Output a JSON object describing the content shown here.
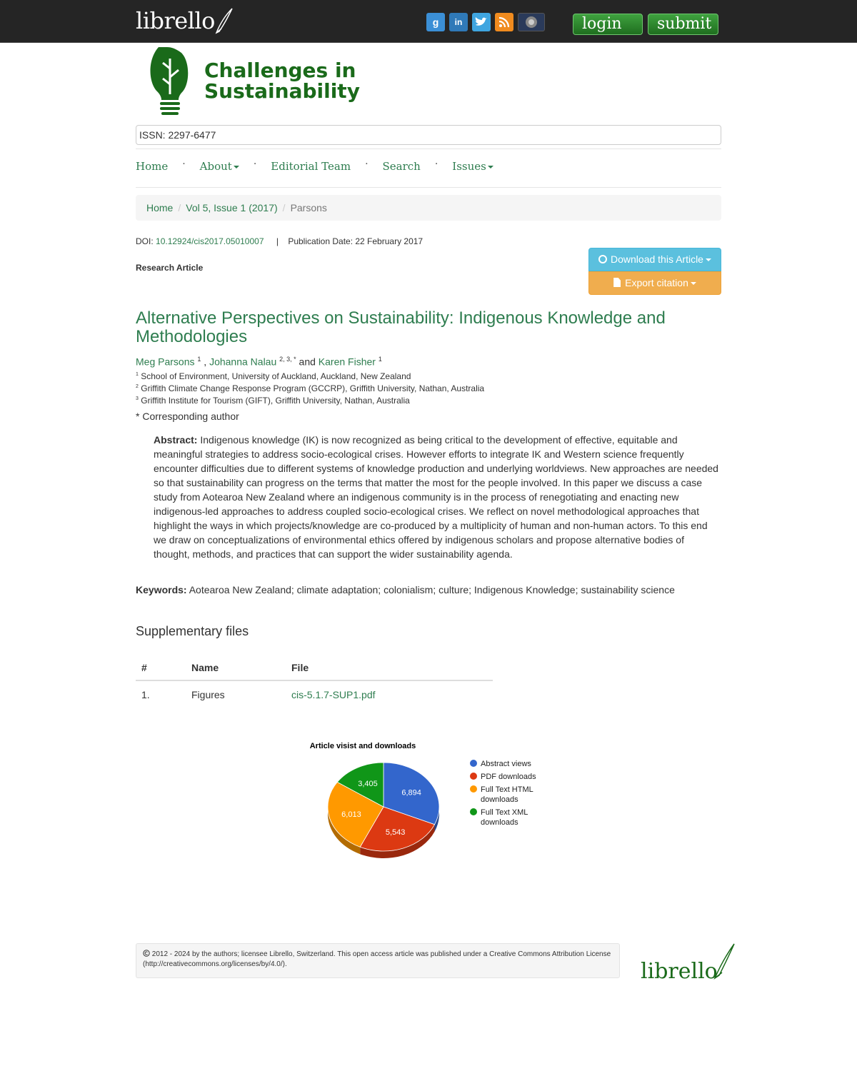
{
  "topbar": {
    "brand": "librello",
    "social": [
      {
        "name": "google-plus-icon",
        "glyph": "g"
      },
      {
        "name": "linkedin-icon",
        "glyph": "in"
      },
      {
        "name": "twitter-icon",
        "glyph": "t"
      },
      {
        "name": "rss-icon",
        "glyph": "rss"
      },
      {
        "name": "other-social-icon",
        "glyph": ""
      }
    ],
    "login_label": "login",
    "submit_label": "submit"
  },
  "journal": {
    "title_line1": "Challenges in",
    "title_line2": "Sustainability",
    "issn": "ISSN: 2297-6477"
  },
  "nav": {
    "home": "Home",
    "about": "About",
    "editorial": "Editorial Team",
    "search": "Search",
    "issues": "Issues"
  },
  "breadcrumb": {
    "home": "Home",
    "issue": "Vol 5, Issue 1 (2017)",
    "current": "Parsons"
  },
  "article": {
    "doi_label": "DOI:",
    "doi": "10.12924/cis2017.05010007",
    "separator": "|",
    "pub_date": "Publication Date: 22 February 2017",
    "type": "Research Article",
    "download_label": "Download this Article",
    "export_label": "Export citation",
    "title": "Alternative Perspectives on Sustainability: Indigenous Knowledge and Methodologies",
    "authors": [
      {
        "name": "Meg Parsons",
        "sup": "1"
      },
      {
        "name": "Johanna Nalau",
        "sup": "2, 3, *"
      },
      {
        "name": "Karen Fisher",
        "sup": "1"
      }
    ],
    "author_sep1": " ,",
    "author_sep2": " and",
    "affiliations": [
      {
        "sup": "1",
        "text": "School of Environment, University of Auckland, Auckland, New Zealand"
      },
      {
        "sup": "2",
        "text": "Griffith Climate Change Response Program (GCCRP), Griffith University, Nathan, Australia"
      },
      {
        "sup": "3",
        "text": "Griffith Institute for Tourism (GIFT), Griffith University, Nathan, Australia"
      }
    ],
    "corresponding_mark": "*",
    "corresponding": "Corresponding author",
    "abstract_label": "Abstract:",
    "abstract": "Indigenous knowledge (IK) is now recognized as being critical to the development of effective, equitable and meaningful strategies to address socio-ecological crises. However efforts to integrate IK and Western science frequently encounter difficulties due to different systems of knowledge production and underlying worldviews. New approaches are needed so that sustainability can progress on the terms that matter the most for the people involved. In this paper we discuss a case study from Aotearoa New Zealand where an indigenous community is in the process of renegotiating and enacting new indigenous-led approaches to address coupled socio-ecological crises. We reflect on novel methodological approaches that highlight the ways in which projects/knowledge are co-produced by a multiplicity of human and non-human actors. To this end we draw on conceptualizations of environmental ethics offered by indigenous scholars and propose alternative bodies of thought, methods, and practices that can support the wider sustainability agenda.",
    "keywords_label": "Keywords:",
    "keywords": "Aotearoa New Zealand; climate adaptation; colonialism; culture; Indigenous Knowledge; sustainability science"
  },
  "supplementary": {
    "heading": "Supplementary files",
    "columns": [
      "#",
      "Name",
      "File"
    ],
    "rows": [
      {
        "num": "1.",
        "name": "Figures",
        "file": "cis-5.1.7-SUP1.pdf"
      }
    ]
  },
  "chart_data": {
    "type": "pie",
    "title": "Article visist and downloads",
    "categories": [
      "Abstract views",
      "PDF downloads",
      "Full Text HTML downloads",
      "Full Text XML downloads"
    ],
    "legend_lines": [
      [
        "Abstract views"
      ],
      [
        "PDF downloads"
      ],
      [
        "Full Text HTML",
        "downloads"
      ],
      [
        "Full Text XML",
        "downloads"
      ]
    ],
    "values": [
      6894,
      5543,
      6013,
      3405
    ],
    "labels": [
      "6,894",
      "5,543",
      "6,013",
      "3,405"
    ],
    "colors": [
      "#3366cc",
      "#dc3912",
      "#ff9900",
      "#109618"
    ],
    "legend": "right"
  },
  "footer": {
    "copyright_icon": "copyright-icon",
    "text": "2012 - 2024 by the authors; licensee Librello, Switzerland. This open access article was published under a Creative Commons Attribution License (http://creativecommons.org/licenses/by/4.0/).",
    "logo": "librello"
  }
}
